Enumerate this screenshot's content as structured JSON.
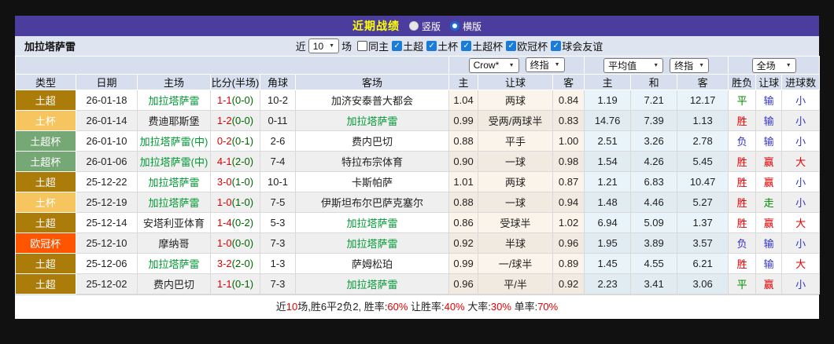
{
  "title_bar": {
    "title": "近期战绩",
    "vertical_label": "竖版",
    "horizontal_label": "横版",
    "selected": "横版"
  },
  "filter_bar": {
    "team": "加拉塔萨雷",
    "near_label": "近",
    "games_count": "10",
    "games_suffix": "场",
    "checkboxes": [
      {
        "label": "同主",
        "checked": false
      },
      {
        "label": "土超",
        "checked": true
      },
      {
        "label": "土杯",
        "checked": true
      },
      {
        "label": "土超杯",
        "checked": true
      },
      {
        "label": "欧冠杯",
        "checked": true
      },
      {
        "label": "球会友谊",
        "checked": true
      }
    ]
  },
  "selectors": {
    "bookmaker": "Crow*",
    "bookmaker_stage": "终指",
    "average": "平均值",
    "average_stage": "终指",
    "scope": "全场"
  },
  "colors": {
    "accent_purple": "#4B3D9E",
    "title_yellow": "#FFFF00",
    "team_green": "#009933",
    "win_red": "#E60000",
    "draw_green": "#008800",
    "loss_blue": "#3333CC",
    "league_super_gold": "#AC7C0B",
    "league_cup_gold": "#F6C55F",
    "league_supercup_green": "#76A876",
    "league_ucl_orange": "#FF5400"
  },
  "table": {
    "headers": [
      "类型",
      "日期",
      "主场",
      "比分(半场)",
      "角球",
      "客场",
      "主",
      "让球",
      "客",
      "主",
      "和",
      "客",
      "胜负",
      "让球",
      "进球数"
    ],
    "rows": [
      {
        "type": "土超",
        "type_color": "#AC7C0B",
        "date": "26-01-18",
        "home": "加拉塔萨雷",
        "home_color": "#009933",
        "score": "1-1",
        "half": "(0-0)",
        "corner": "10-2",
        "away": "加济安泰普大都会",
        "away_color": "#222222",
        "handicap_home": "1.04",
        "handicap_line": "两球",
        "handicap_away": "0.84",
        "avg_home": "1.19",
        "avg_draw": "7.21",
        "avg_away": "12.17",
        "outcome": "平",
        "outcome_color": "#008800",
        "handicap_result": "输",
        "handicap_result_color": "#3333CC",
        "goals_result": "小",
        "goals_result_color": "#3333CC"
      },
      {
        "type": "土杯",
        "type_color": "#F6C55F",
        "date": "26-01-14",
        "home": "费迪耶斯堡",
        "home_color": "#222222",
        "score": "1-2",
        "half": "(0-0)",
        "corner": "0-11",
        "away": "加拉塔萨雷",
        "away_color": "#009933",
        "handicap_home": "0.99",
        "handicap_line": "受两/两球半",
        "handicap_away": "0.83",
        "avg_home": "14.76",
        "avg_draw": "7.39",
        "avg_away": "1.13",
        "outcome": "胜",
        "outcome_color": "#E60000",
        "handicap_result": "输",
        "handicap_result_color": "#3333CC",
        "goals_result": "小",
        "goals_result_color": "#3333CC"
      },
      {
        "type": "土超杯",
        "type_color": "#76A876",
        "date": "26-01-10",
        "home": "加拉塔萨雷(中)",
        "home_color": "#009933",
        "score": "0-2",
        "half": "(0-1)",
        "corner": "2-6",
        "away": "费内巴切",
        "away_color": "#222222",
        "handicap_home": "0.88",
        "handicap_line": "平手",
        "handicap_away": "1.00",
        "avg_home": "2.51",
        "avg_draw": "3.26",
        "avg_away": "2.78",
        "outcome": "负",
        "outcome_color": "#3333CC",
        "handicap_result": "输",
        "handicap_result_color": "#3333CC",
        "goals_result": "小",
        "goals_result_color": "#3333CC"
      },
      {
        "type": "土超杯",
        "type_color": "#76A876",
        "date": "26-01-06",
        "home": "加拉塔萨雷(中)",
        "home_color": "#009933",
        "score": "4-1",
        "half": "(2-0)",
        "corner": "7-4",
        "away": "特拉布宗体育",
        "away_color": "#222222",
        "handicap_home": "0.90",
        "handicap_line": "一球",
        "handicap_away": "0.98",
        "avg_home": "1.54",
        "avg_draw": "4.26",
        "avg_away": "5.45",
        "outcome": "胜",
        "outcome_color": "#E60000",
        "handicap_result": "赢",
        "handicap_result_color": "#E60000",
        "goals_result": "大",
        "goals_result_color": "#E60000"
      },
      {
        "type": "土超",
        "type_color": "#AC7C0B",
        "date": "25-12-22",
        "home": "加拉塔萨雷",
        "home_color": "#009933",
        "score": "3-0",
        "half": "(1-0)",
        "corner": "10-1",
        "away": "卡斯帕萨",
        "away_color": "#222222",
        "handicap_home": "1.01",
        "handicap_line": "两球",
        "handicap_away": "0.87",
        "avg_home": "1.21",
        "avg_draw": "6.83",
        "avg_away": "10.47",
        "outcome": "胜",
        "outcome_color": "#E60000",
        "handicap_result": "赢",
        "handicap_result_color": "#E60000",
        "goals_result": "小",
        "goals_result_color": "#3333CC"
      },
      {
        "type": "土杯",
        "type_color": "#F6C55F",
        "date": "25-12-19",
        "home": "加拉塔萨雷",
        "home_color": "#009933",
        "score": "1-0",
        "half": "(1-0)",
        "corner": "7-5",
        "away": "伊斯坦布尔巴萨克塞尔",
        "away_color": "#222222",
        "handicap_home": "0.88",
        "handicap_line": "一球",
        "handicap_away": "0.94",
        "avg_home": "1.48",
        "avg_draw": "4.46",
        "avg_away": "5.27",
        "outcome": "胜",
        "outcome_color": "#E60000",
        "handicap_result": "走",
        "handicap_result_color": "#008800",
        "goals_result": "小",
        "goals_result_color": "#3333CC"
      },
      {
        "type": "土超",
        "type_color": "#AC7C0B",
        "date": "25-12-14",
        "home": "安塔利亚体育",
        "home_color": "#222222",
        "score": "1-4",
        "half": "(0-2)",
        "corner": "5-3",
        "away": "加拉塔萨雷",
        "away_color": "#009933",
        "handicap_home": "0.86",
        "handicap_line": "受球半",
        "handicap_away": "1.02",
        "avg_home": "6.94",
        "avg_draw": "5.09",
        "avg_away": "1.37",
        "outcome": "胜",
        "outcome_color": "#E60000",
        "handicap_result": "赢",
        "handicap_result_color": "#E60000",
        "goals_result": "大",
        "goals_result_color": "#E60000"
      },
      {
        "type": "欧冠杯",
        "type_color": "#FF5400",
        "date": "25-12-10",
        "home": "摩纳哥",
        "home_color": "#222222",
        "score": "1-0",
        "half": "(0-0)",
        "corner": "7-3",
        "away": "加拉塔萨雷",
        "away_color": "#009933",
        "handicap_home": "0.92",
        "handicap_line": "半球",
        "handicap_away": "0.96",
        "avg_home": "1.95",
        "avg_draw": "3.89",
        "avg_away": "3.57",
        "outcome": "负",
        "outcome_color": "#3333CC",
        "handicap_result": "输",
        "handicap_result_color": "#3333CC",
        "goals_result": "小",
        "goals_result_color": "#3333CC"
      },
      {
        "type": "土超",
        "type_color": "#AC7C0B",
        "date": "25-12-06",
        "home": "加拉塔萨雷",
        "home_color": "#009933",
        "score": "3-2",
        "half": "(2-0)",
        "corner": "1-3",
        "away": "萨姆松珀",
        "away_color": "#222222",
        "handicap_home": "0.99",
        "handicap_line": "一/球半",
        "handicap_away": "0.89",
        "avg_home": "1.45",
        "avg_draw": "4.55",
        "avg_away": "6.21",
        "outcome": "胜",
        "outcome_color": "#E60000",
        "handicap_result": "输",
        "handicap_result_color": "#3333CC",
        "goals_result": "大",
        "goals_result_color": "#E60000"
      },
      {
        "type": "土超",
        "type_color": "#AC7C0B",
        "date": "25-12-02",
        "home": "费内巴切",
        "home_color": "#222222",
        "score": "1-1",
        "half": "(0-1)",
        "corner": "7-3",
        "away": "加拉塔萨雷",
        "away_color": "#009933",
        "handicap_home": "0.96",
        "handicap_line": "平/半",
        "handicap_away": "0.92",
        "avg_home": "2.23",
        "avg_draw": "3.41",
        "avg_away": "3.06",
        "outcome": "平",
        "outcome_color": "#008800",
        "handicap_result": "赢",
        "handicap_result_color": "#E60000",
        "goals_result": "小",
        "goals_result_color": "#3333CC"
      }
    ]
  },
  "footer": {
    "t1": "近",
    "v1": "10",
    "t2": "场,胜6平2负2, 胜率:",
    "v2": "60%",
    "t3": " 让胜率:",
    "v3": "40%",
    "t4": " 大率:",
    "v4": "30%",
    "t5": " 单率:",
    "v5": "70%"
  }
}
